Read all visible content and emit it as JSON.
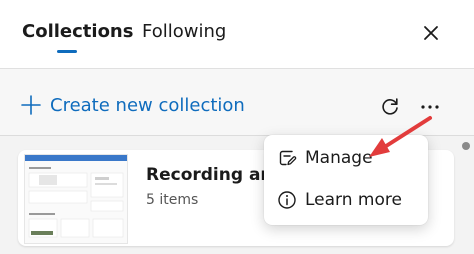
{
  "tabs": {
    "collections": "Collections",
    "following": "Following"
  },
  "toolbar": {
    "create_label": "Create new collection"
  },
  "collection_card": {
    "title": "Recording and",
    "count": "5 items"
  },
  "context_menu": {
    "items": [
      {
        "label": "Manage",
        "icon": "edit-note-icon"
      },
      {
        "label": "Learn more",
        "icon": "info-icon"
      }
    ]
  },
  "colors": {
    "accent": "#0f6cbd",
    "annotation_arrow": "#e23c3c"
  }
}
